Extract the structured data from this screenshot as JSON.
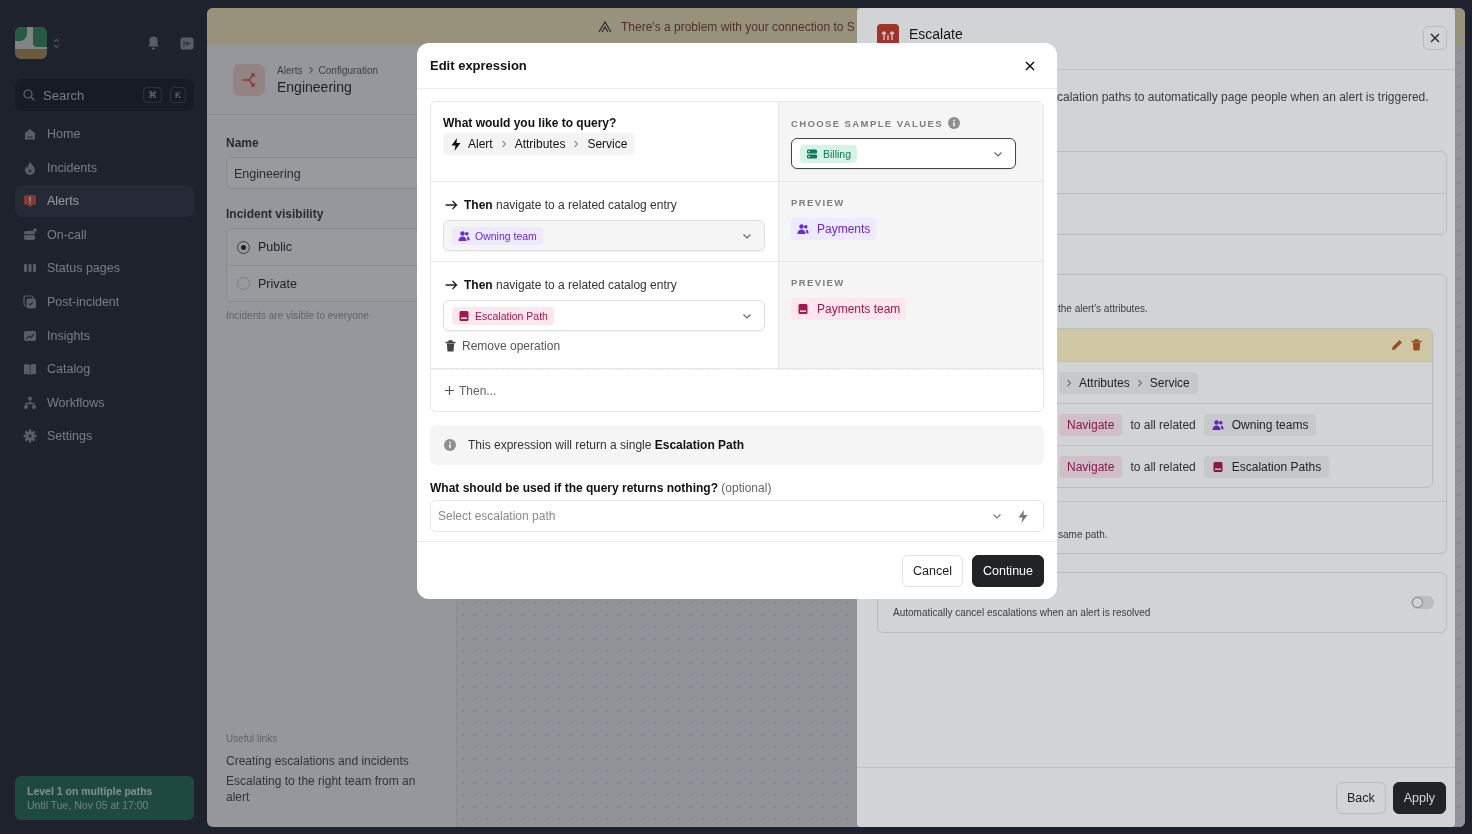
{
  "sidebar": {
    "search": {
      "placeholder": "Search",
      "keys": [
        "⌘",
        "K"
      ]
    },
    "items": [
      {
        "label": "Home",
        "selected": false
      },
      {
        "label": "Incidents",
        "selected": false
      },
      {
        "label": "Alerts",
        "selected": true
      },
      {
        "label": "On-call",
        "selected": false
      },
      {
        "label": "Status pages",
        "selected": false
      },
      {
        "label": "Post-incident",
        "selected": false
      },
      {
        "label": "Insights",
        "selected": false
      },
      {
        "label": "Catalog",
        "selected": false
      },
      {
        "label": "Workflows",
        "selected": false
      },
      {
        "label": "Settings",
        "selected": false
      }
    ],
    "status_card": {
      "title": "Level 1 on multiple paths",
      "subtitle": "Until Tue, Nov 05 at 17:00"
    }
  },
  "banner": {
    "text": "There's a problem with your connection to S"
  },
  "page": {
    "breadcrumb": [
      "Alerts",
      "Configuration"
    ],
    "title": "Engineering",
    "name_label": "Name",
    "name_value": "Engineering",
    "visibility_label": "Incident visibility",
    "visibility_options": [
      {
        "label": "Public",
        "selected": true
      },
      {
        "label": "Private",
        "selected": false
      }
    ],
    "visibility_hint": "Incidents are visible to everyone",
    "links_heading": "Useful links",
    "links": [
      "Creating escalations and incidents",
      "Escalating to the right team from an alert"
    ]
  },
  "drawer": {
    "title": "Escalate",
    "description": "calation paths to automatically page people when an alert is triggered.",
    "section_text": "the alert's attributes.",
    "rows": [
      {
        "kind": "path",
        "items": [
          "Attributes",
          "Service"
        ]
      },
      {
        "kind": "navigate",
        "action": "Navigate",
        "text": "to all related",
        "target": {
          "label": "Owning teams",
          "kind": "team"
        }
      },
      {
        "kind": "navigate",
        "action": "Navigate",
        "text": "to all related",
        "target": {
          "label": "Escalation Paths",
          "kind": "escalation"
        }
      }
    ],
    "section_footer": "same path.",
    "auto_cancel": {
      "text": "Automatically cancel escalations when an alert is resolved",
      "on": false
    },
    "buttons": [
      {
        "label": "Back",
        "kind": "secondary"
      },
      {
        "label": "Apply",
        "kind": "primary"
      }
    ]
  },
  "modal": {
    "title": "Edit expression",
    "query": {
      "question": "What would you like to query?",
      "path": [
        "Alert",
        "Attributes",
        "Service"
      ]
    },
    "sample": {
      "label": "CHOOSE SAMPLE VALUES",
      "value": "Billing",
      "kind": "service"
    },
    "operations": [
      {
        "text": "**Then** navigate to a related catalog entry",
        "value": "Owning team",
        "kind": "team",
        "preview_label": "PREVIEW",
        "preview": "Payments"
      },
      {
        "text": "**Then** navigate to a related catalog entry",
        "value": "Escalation Path",
        "kind": "escalation",
        "preview_label": "PREVIEW",
        "preview": "Payments team",
        "remove": "Remove operation"
      }
    ],
    "add_step": "Then...",
    "info": "This expression will return a single **Escalation Path**",
    "fallback": {
      "label": "What should be used if the query returns nothing?",
      "optional": "(optional)",
      "placeholder": "Select escalation path"
    },
    "buttons": [
      {
        "label": "Cancel",
        "kind": "secondary"
      },
      {
        "label": "Continue",
        "kind": "primary"
      }
    ]
  }
}
